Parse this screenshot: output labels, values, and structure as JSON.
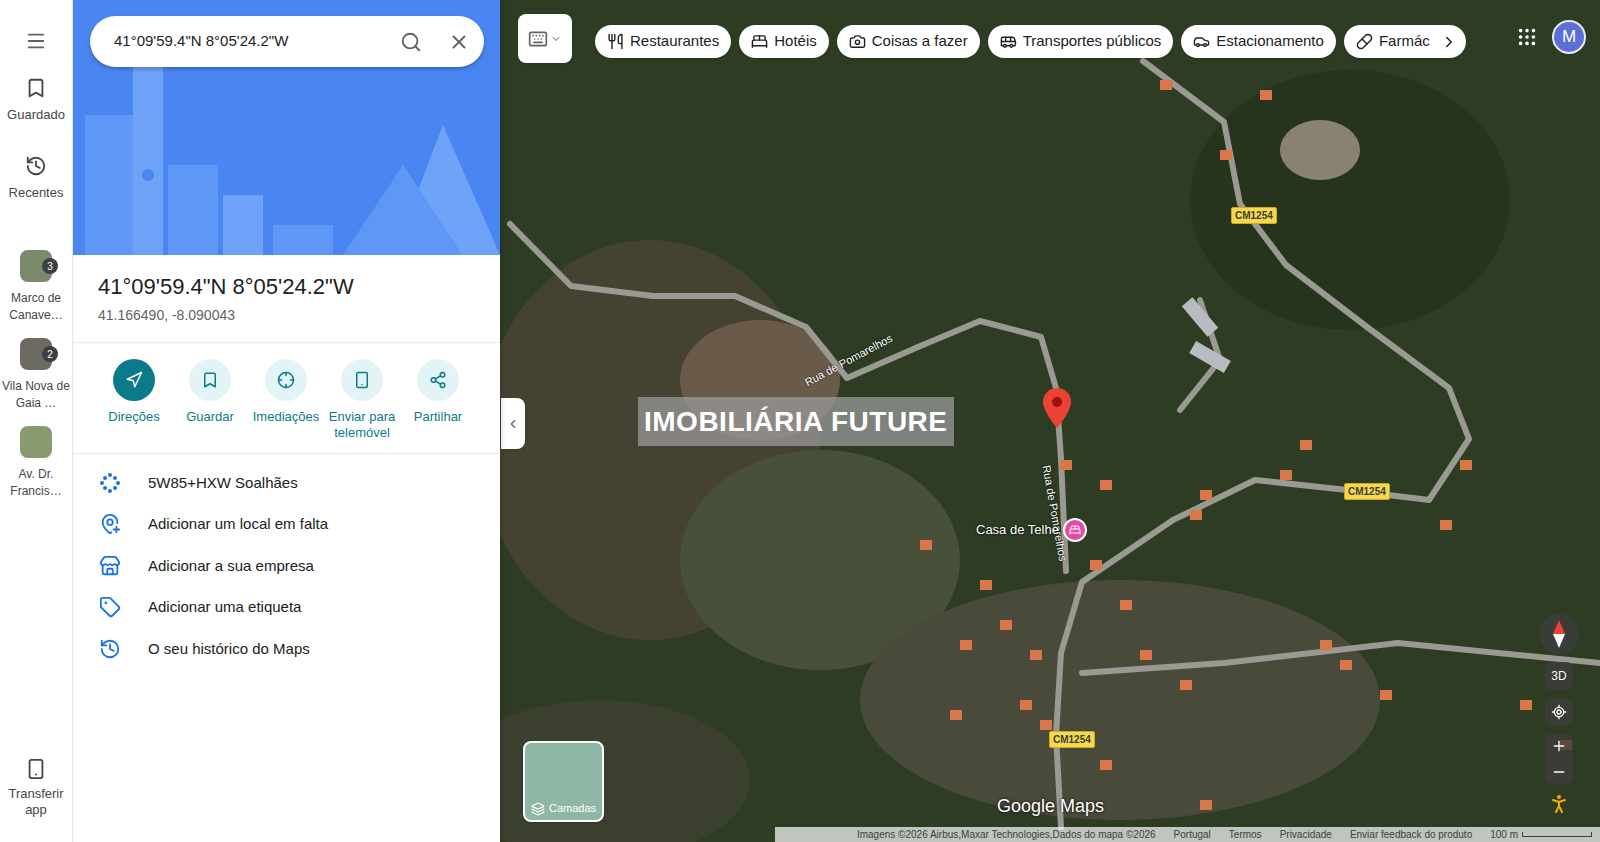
{
  "search": {
    "value": "41°09'59.4\"N 8°05'24.2\"W"
  },
  "rail": {
    "items": [
      {
        "label": "Guardado"
      },
      {
        "label": "Recentes"
      }
    ],
    "recent": [
      {
        "label": "Marco de Canave…",
        "count": "3"
      },
      {
        "label": "Vila Nova de Gaia …",
        "count": "2"
      },
      {
        "label": "Av. Dr. Francis…",
        "count": ""
      }
    ],
    "bottom": "Transferir app"
  },
  "place": {
    "title": "41°09'59.4\"N 8°05'24.2\"W",
    "coords": "41.166490, -8.090043"
  },
  "actions": [
    {
      "label": "Direções",
      "kind": "primary"
    },
    {
      "label": "Guardar",
      "kind": "secondary"
    },
    {
      "label": "Imediações",
      "kind": "secondary"
    },
    {
      "label": "Enviar para telemóvel",
      "kind": "secondary"
    },
    {
      "label": "Partilhar",
      "kind": "secondary"
    }
  ],
  "details": [
    "5W85+HXW Soalhães",
    "Adicionar um local em falta",
    "Adicionar a sua empresa",
    "Adicionar uma etiqueta",
    "O seu histórico do Maps"
  ],
  "chips": [
    "Restaurantes",
    "Hotéis",
    "Coisas a fazer",
    "Transportes públicos",
    "Estacionamento",
    "Farmác"
  ],
  "avatar": "M",
  "map": {
    "roads": [
      "Rua de Pomarelhos",
      "Rua de Pomarelhos"
    ],
    "shields": [
      "CM1254",
      "CM1254",
      "CM1254"
    ],
    "place": "Casa de Telhe",
    "watermark": "IMOBILIÁRIA FUTURE",
    "layers": "Camadas",
    "tilt": "3D",
    "logo": "Google Maps",
    "attribution": [
      "Imagens ©2026 Airbus,Maxar Technologies,Dados do mapa ©2026",
      "Portugal",
      "Termos",
      "Privacidade",
      "Enviar feedback do produto"
    ],
    "scale": "100 m"
  }
}
